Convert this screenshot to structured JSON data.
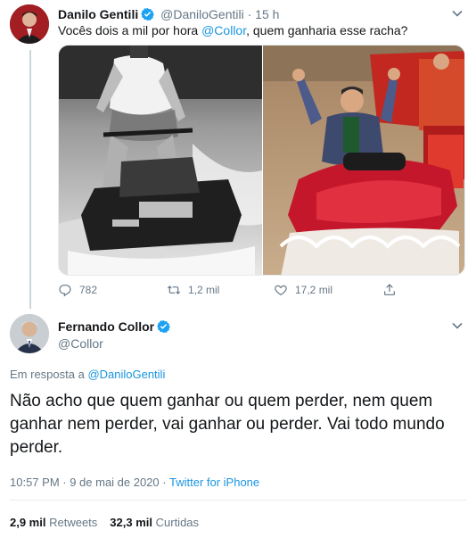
{
  "tweet1": {
    "author_name": "Danilo Gentili",
    "author_handle": "@DaniloGentili",
    "separator": "·",
    "time": "15 h",
    "text_before": "Vocês dois a mil por hora ",
    "text_mention": "@Collor",
    "text_after": ", quem ganharia esse racha?",
    "actions": {
      "replies": "782",
      "retweets": "1,2 mil",
      "likes": "17,2 mil"
    }
  },
  "tweet2": {
    "author_name": "Fernando Collor",
    "author_handle": "@Collor",
    "reply_prefix": "Em resposta a ",
    "reply_mention": "@DaniloGentili",
    "text": "Não acho que quem ganhar ou quem perder, nem quem ganhar nem perder, vai ganhar ou perder. Vai todo mundo perder.",
    "timestamp": "10:57 PM · 9 de mai de 2020 · ",
    "source": "Twitter for iPhone",
    "retweets_count": "2,9 mil",
    "retweets_label": "Retweets",
    "likes_count": "32,3 mil",
    "likes_label": "Curtidas"
  },
  "colors": {
    "accent": "#1b95e0",
    "verified": "#1da1f2",
    "muted": "#657786",
    "text": "#14171a",
    "divider": "#e6ecf0"
  },
  "icons": [
    "verified-badge-icon",
    "chevron-down-icon",
    "reply-icon",
    "retweet-icon",
    "like-icon",
    "share-icon"
  ]
}
